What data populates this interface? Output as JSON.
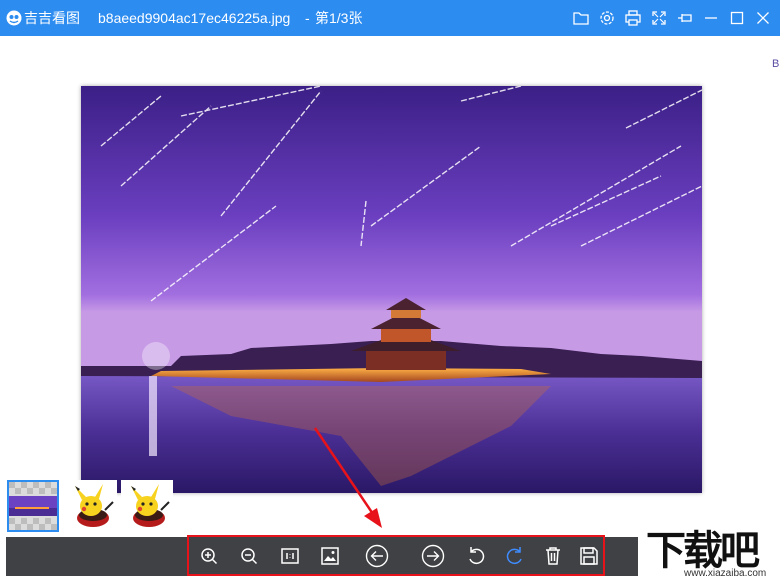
{
  "titlebar": {
    "app_name": "吉吉看图",
    "file_name": "b8aeed9904ac17ec46225a.jpg",
    "separator": "-",
    "page_count": "第1/3张",
    "background": "#2d8cf0",
    "buttons": [
      "folder-icon",
      "settings-icon",
      "print-icon",
      "fullscreen-icon",
      "pin-icon",
      "minimize-icon",
      "maximize-icon",
      "close-icon"
    ]
  },
  "viewer": {
    "side_glyph": "B",
    "photo": "night-scene-forbidden-city-corner-tower-with-star-trails"
  },
  "thumbnails": [
    {
      "name": "purple-night-photo",
      "selected": true
    },
    {
      "name": "pikachu-image",
      "selected": false
    },
    {
      "name": "pikachu-image",
      "selected": false
    }
  ],
  "toolbar": {
    "tools": [
      "zoom-in-icon",
      "zoom-out-icon",
      "actual-size-icon",
      "fit-image-icon",
      "previous-icon",
      "next-icon",
      "rotate-left-icon",
      "rotate-right-icon",
      "delete-icon",
      "save-icon"
    ],
    "highlight_color": "#e8131a"
  },
  "watermark": {
    "title": "下载吧",
    "url": "www.xiazaiba.com"
  }
}
